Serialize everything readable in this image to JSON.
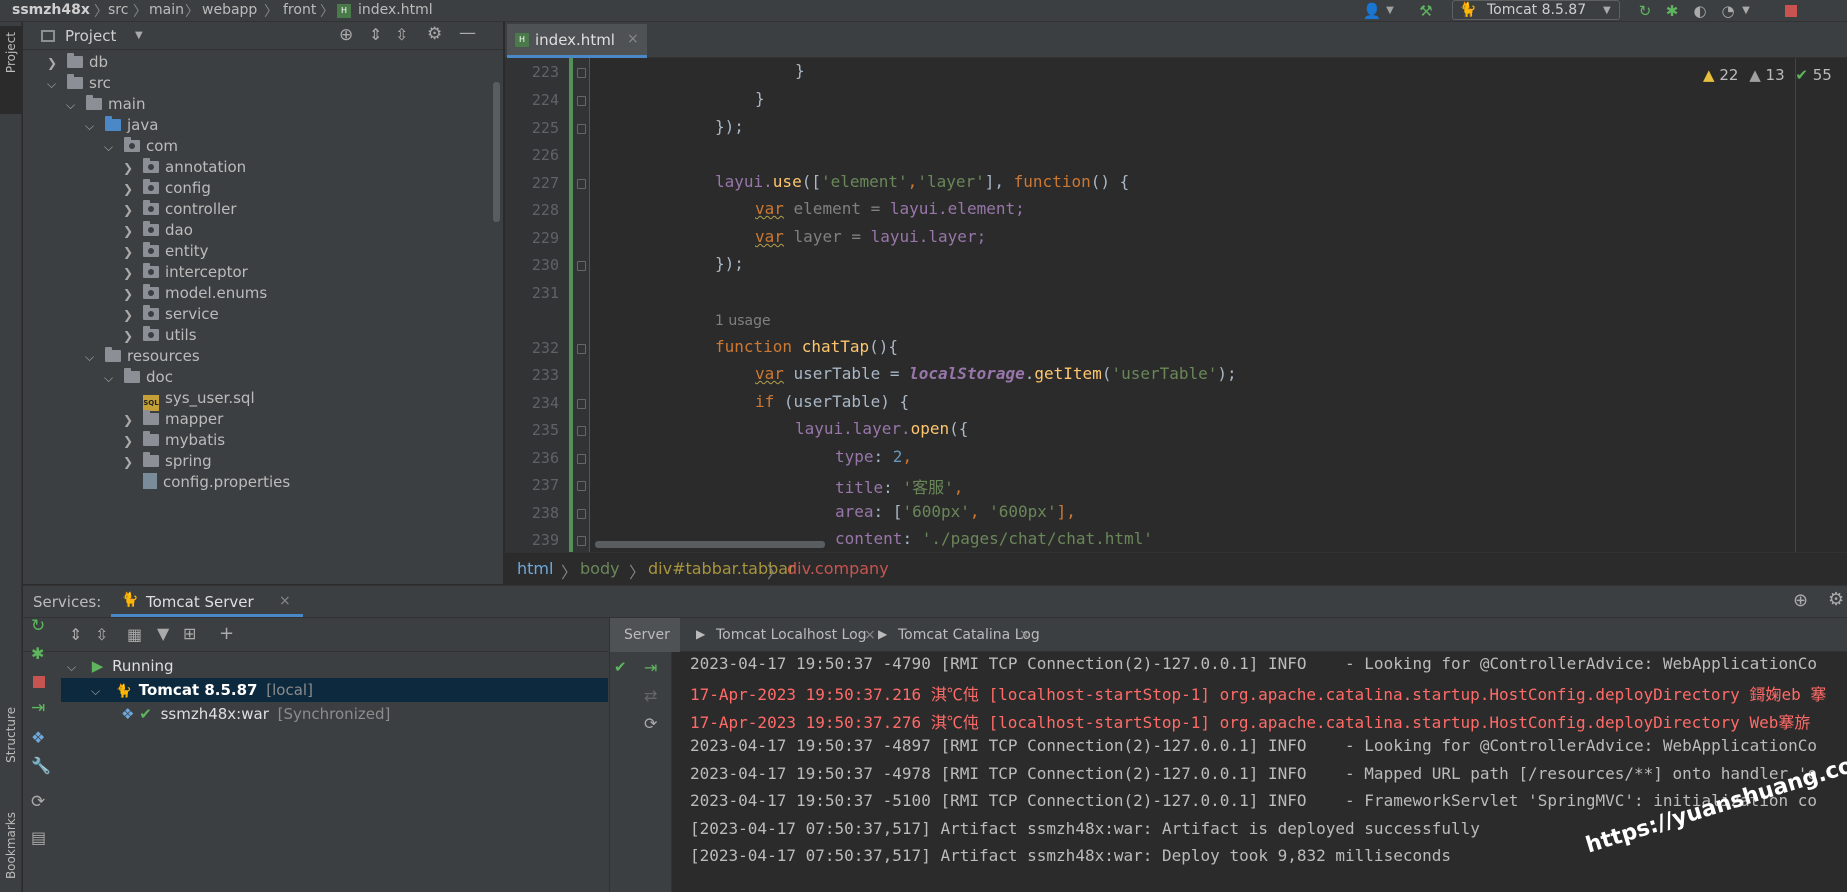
{
  "breadcrumb": {
    "project": "ssmzh48x",
    "items": [
      "src",
      "main",
      "webapp",
      "front",
      "index.html"
    ]
  },
  "run_config": {
    "label": "Tomcat 8.5.87"
  },
  "left_strip": {
    "project": "Project",
    "structure": "Structure",
    "bookmarks": "Bookmarks"
  },
  "project_panel": {
    "title": "Project",
    "tree": [
      {
        "label": "db",
        "expanded": false
      },
      {
        "label": "src",
        "expanded": true
      },
      {
        "label": "main",
        "expanded": true
      },
      {
        "label": "java",
        "expanded": true
      },
      {
        "label": "com",
        "expanded": true
      },
      {
        "label": "annotation",
        "expanded": false
      },
      {
        "label": "config",
        "expanded": false
      },
      {
        "label": "controller",
        "expanded": false
      },
      {
        "label": "dao",
        "expanded": false
      },
      {
        "label": "entity",
        "expanded": false
      },
      {
        "label": "interceptor",
        "expanded": false
      },
      {
        "label": "model.enums",
        "expanded": false
      },
      {
        "label": "service",
        "expanded": false
      },
      {
        "label": "utils",
        "expanded": false
      },
      {
        "label": "resources",
        "expanded": true
      },
      {
        "label": "doc",
        "expanded": true
      },
      {
        "label": "sys_user.sql"
      },
      {
        "label": "mapper",
        "expanded": false
      },
      {
        "label": "mybatis",
        "expanded": false
      },
      {
        "label": "spring",
        "expanded": false
      },
      {
        "label": "config.properties"
      }
    ]
  },
  "editor": {
    "tab_label": "index.html",
    "tab_close": "×",
    "inspections": {
      "warnings": "22",
      "weak_warnings": "13",
      "ok": "55"
    },
    "line_numbers": [
      "223",
      "224",
      "225",
      "226",
      "227",
      "228",
      "229",
      "230",
      "231",
      "232",
      "233",
      "234",
      "235",
      "236",
      "237",
      "238",
      "239"
    ],
    "usage_hint": "1 usage",
    "code": {
      "l223": "}",
      "l224": "}",
      "l225": "});",
      "l227_a": "layui.",
      "l227_b": "use",
      "l227_c": "([",
      "l227_d": "'element'",
      "l227_e": ",",
      "l227_f": "'layer'",
      "l227_g": "], ",
      "l227_h": "function",
      "l227_i": "() {",
      "l228_a": "var",
      "l228_b": " element = ",
      "l228_c": "layui.element;",
      "l229_a": "var",
      "l229_b": " layer = ",
      "l229_c": "layui.layer;",
      "l230": "});",
      "l232_a": "function",
      "l232_b": " chatTap",
      "l232_c": "(){",
      "l233_a": "var",
      "l233_b": " userTable = ",
      "l233_c": "localStorage",
      "l233_d": ".",
      "l233_e": "getItem",
      "l233_f": "(",
      "l233_g": "'userTable'",
      "l233_h": ");",
      "l234_a": "if",
      "l234_b": " (userTable) {",
      "l235_a": "layui.layer.",
      "l235_b": "open",
      "l235_c": "({",
      "l236_a": "type",
      "l236_b": ": ",
      "l236_c": "2",
      "l236_d": ",",
      "l237_a": "title",
      "l237_b": ": ",
      "l237_c": "'客服'",
      "l237_d": ",",
      "l238_a": "area",
      "l238_b": ": [",
      "l238_c": "'600px'",
      "l238_d": ", ",
      "l238_e": "'600px'",
      "l238_f": "],",
      "l239_a": "content",
      "l239_b": ": ",
      "l239_c": "'./pages/chat/chat.html'"
    },
    "crumbs": [
      "html",
      "body",
      "div#tabbar.tabbar",
      "div.company"
    ]
  },
  "services": {
    "title": "Services:",
    "tab_label": "Tomcat Server",
    "tree": {
      "running": "Running",
      "server": "Tomcat 8.5.87",
      "server_suffix": "[local]",
      "artifact": "ssmzh48x:war",
      "artifact_status": "[Synchronized]"
    },
    "log_tabs": [
      "Server",
      "Tomcat Localhost Log",
      "Tomcat Catalina Log"
    ],
    "log_lines": [
      {
        "text": "2023-04-17 19:50:37 -4790 [RMI TCP Connection(2)-127.0.0.1] INFO    - Looking for @ControllerAdvice: WebApplicationCo",
        "level": "info"
      },
      {
        "text": "17-Apr-2023 19:50:37.216 淇℃伅 [localhost-startStop-1] org.apache.catalina.startup.HostConfig.deployDirectory 鎶婅eb 搴",
        "level": "error"
      },
      {
        "text": "17-Apr-2023 19:50:37.276 淇℃伅 [localhost-startStop-1] org.apache.catalina.startup.HostConfig.deployDirectory Web搴旂",
        "level": "error"
      },
      {
        "text": "2023-04-17 19:50:37 -4897 [RMI TCP Connection(2)-127.0.0.1] INFO    - Looking for @ControllerAdvice: WebApplicationCo",
        "level": "info"
      },
      {
        "text": "2023-04-17 19:50:37 -4978 [RMI TCP Connection(2)-127.0.0.1] INFO    - Mapped URL path [/resources/**] onto handler 'o",
        "level": "info"
      },
      {
        "text": "2023-04-17 19:50:37 -5100 [RMI TCP Connection(2)-127.0.0.1] INFO    - FrameworkServlet 'SpringMVC': initialization co",
        "level": "info"
      },
      {
        "text": "[2023-04-17 07:50:37,517] Artifact ssmzh48x:war: Artifact is deployed successfully",
        "level": "info"
      },
      {
        "text": "[2023-04-17 07:50:37,517] Artifact ssmzh48x:war: Deploy took 9,832 milliseconds",
        "level": "info"
      }
    ]
  },
  "watermark": "https://yuanshuang.com"
}
